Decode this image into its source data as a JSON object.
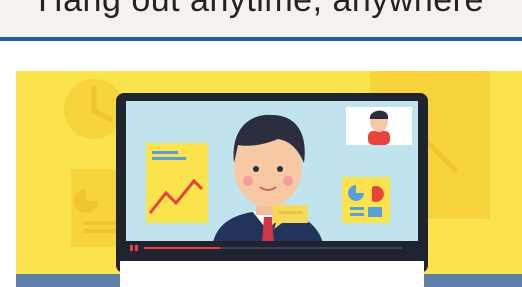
{
  "header": {
    "title": "Hang out anytime, anywhere"
  },
  "hero": {
    "illustration": "video-call-laptop-illustration",
    "icons": [
      "clock-icon",
      "pie-chart-icon",
      "line-chart-icon",
      "chat-bubble-icon",
      "progress-bar-icon",
      "webcam-thumbnail-icon"
    ]
  },
  "colors": {
    "header_bg": "#f4f1ee",
    "accent_rule": "#1f5fa8",
    "hero_bg": "#fbe34d",
    "screen_bg": "#bfe4ee",
    "laptop_frame": "#1f2430",
    "desk_band": "#5b7fa6",
    "chart_card": "#fbe34d",
    "chart_line": "#e8433d",
    "bubble": "#f6d95a",
    "progress": "#e8433d"
  }
}
